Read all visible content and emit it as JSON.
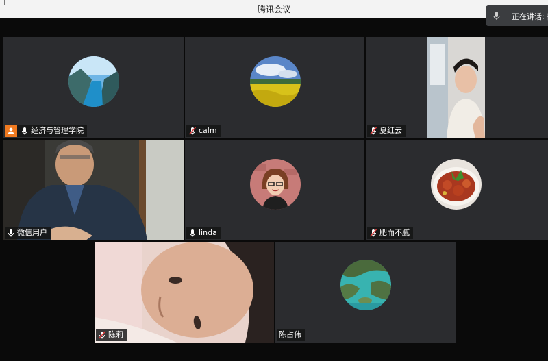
{
  "window": {
    "title": "腾讯会议"
  },
  "speaking_indicator": {
    "label": "正在讲话: 微"
  },
  "participants": [
    {
      "name": "经济与管理学院",
      "muted": false,
      "host": true,
      "avatar": "fjord-landscape-avatar"
    },
    {
      "name": "calm",
      "muted": true,
      "avatar": "rapeseed-field-avatar"
    },
    {
      "name": "夏红云",
      "muted": true,
      "avatar": "camera-video"
    },
    {
      "name": "微信用户",
      "muted": false,
      "speaking": true,
      "avatar": "camera-video"
    },
    {
      "name": "linda",
      "muted": false,
      "avatar": "cartoon-woman-avatar"
    },
    {
      "name": "肥而不腻",
      "muted": true,
      "avatar": "braised-pork-dish-avatar"
    },
    {
      "name": "陈莉",
      "muted": true,
      "avatar": "camera-video"
    },
    {
      "name": "陈占伟",
      "muted": false,
      "avatar": "island-bay-avatar"
    }
  ],
  "colors": {
    "tile_bg": "#2b2c2f",
    "active_border": "#2fbf5a",
    "host_badge": "#f07a20",
    "muted_mic": "#e03c3c"
  }
}
